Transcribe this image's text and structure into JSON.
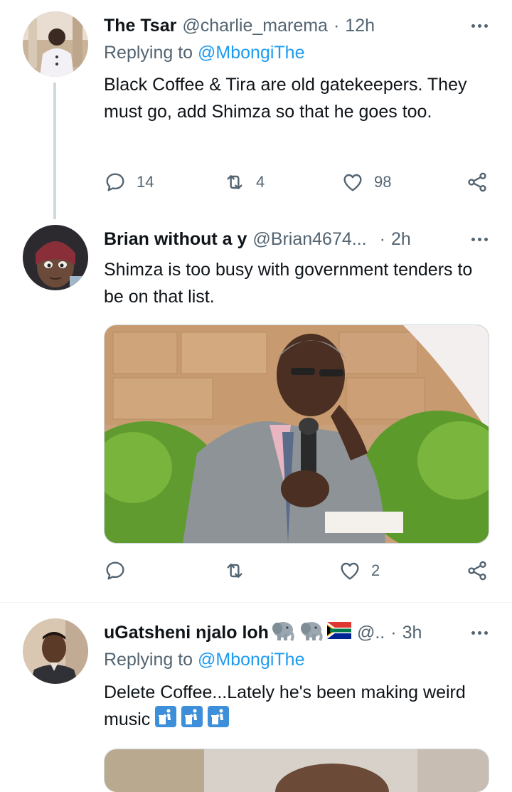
{
  "tweets": [
    {
      "name": "The Tsar",
      "handle": "@charlie_marema",
      "dot": "·",
      "time": "12h",
      "replying_prefix": "Replying to",
      "replying_to": "@MbongiThe",
      "text": "Black Coffee & Tira are old gatekeepers. They must go, add Shimza so that he goes too.",
      "replies": "14",
      "retweets": "4",
      "likes": "98"
    },
    {
      "name": "Brian without a y",
      "handle": "@Brian4674...",
      "dot": "·",
      "time": "2h",
      "text": "Shimza is too busy with government tenders to be on that list.",
      "replies": "",
      "retweets": "",
      "likes": "2"
    },
    {
      "name": "uGatsheni njalo loh",
      "handle": "@..",
      "dot": "·",
      "time": "3h",
      "replying_prefix": "Replying to",
      "replying_to": "@MbongiThe",
      "text": "Delete Coffee...Lately he's been making weird music"
    }
  ],
  "icons": {
    "more": "more-horizontal-icon",
    "reply": "reply-bubble-icon",
    "retweet": "retweet-icon",
    "like": "heart-icon",
    "share": "share-icon",
    "elephant": "elephant-emoji",
    "flag": "south-africa-flag-emoji",
    "litter": "litter-in-bin-emoji"
  },
  "colors": {
    "text": "#0f1419",
    "secondary": "#536471",
    "link": "#1d9bf0",
    "thread_line": "#cfd9de"
  }
}
